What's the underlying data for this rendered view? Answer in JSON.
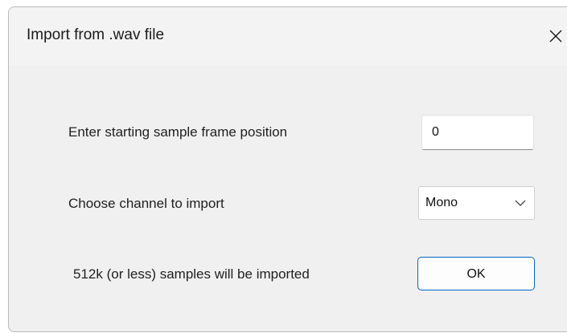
{
  "window": {
    "title": "Import from .wav file",
    "close_glyph": "✕",
    "close_icon": "close-icon"
  },
  "form": {
    "start_label": "Enter starting sample frame position",
    "start_value": "0",
    "channel_label": "Choose channel to import",
    "channel_selected": "Mono",
    "channel_chevron_icon": "chevron-down-icon",
    "info_text": "512k (or less) samples will be imported",
    "ok_label": "OK"
  },
  "colors": {
    "dialog_background": "#f0f0f0",
    "ok_border_accent": "#0067c0"
  }
}
